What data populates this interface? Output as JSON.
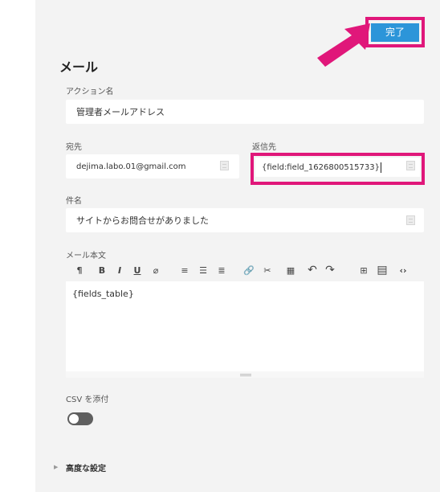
{
  "toolbar_top": {
    "done_label": "完了"
  },
  "section": {
    "title": "メール"
  },
  "action_name": {
    "label": "アクション名",
    "value": "管理者メールアドレス"
  },
  "to": {
    "label": "宛先",
    "value": "dejima.labo.01@gmail.com"
  },
  "reply_to": {
    "label": "返信先",
    "value": "{field:field_1626800515733}"
  },
  "subject": {
    "label": "件名",
    "value": "サイトからお問合せがありました"
  },
  "body": {
    "label": "メール本文",
    "content": "{fields_table}",
    "toolbar": [
      {
        "name": "paragraph",
        "glyph": "¶"
      },
      {
        "name": "bold",
        "glyph": "B"
      },
      {
        "name": "italic",
        "glyph": "I"
      },
      {
        "name": "underline",
        "glyph": "U"
      },
      {
        "name": "eraser",
        "glyph": "⌀"
      },
      {
        "name": "ordered-list",
        "glyph": "≡"
      },
      {
        "name": "unordered-list",
        "glyph": "☰"
      },
      {
        "name": "align",
        "glyph": "≣"
      },
      {
        "name": "link",
        "glyph": "🔗"
      },
      {
        "name": "unlink",
        "glyph": "✂"
      },
      {
        "name": "table",
        "glyph": "▦"
      },
      {
        "name": "undo",
        "glyph": "↶"
      },
      {
        "name": "redo",
        "glyph": "↷"
      },
      {
        "name": "add-field",
        "glyph": "⊞"
      },
      {
        "name": "fields-table",
        "glyph": "▤"
      },
      {
        "name": "code",
        "glyph": "‹›"
      }
    ]
  },
  "csv": {
    "label": "CSV を添付",
    "enabled": false
  },
  "advanced": {
    "label": "高度な設定"
  },
  "colors": {
    "accent": "#2c95d9",
    "highlight": "#e0177a"
  }
}
